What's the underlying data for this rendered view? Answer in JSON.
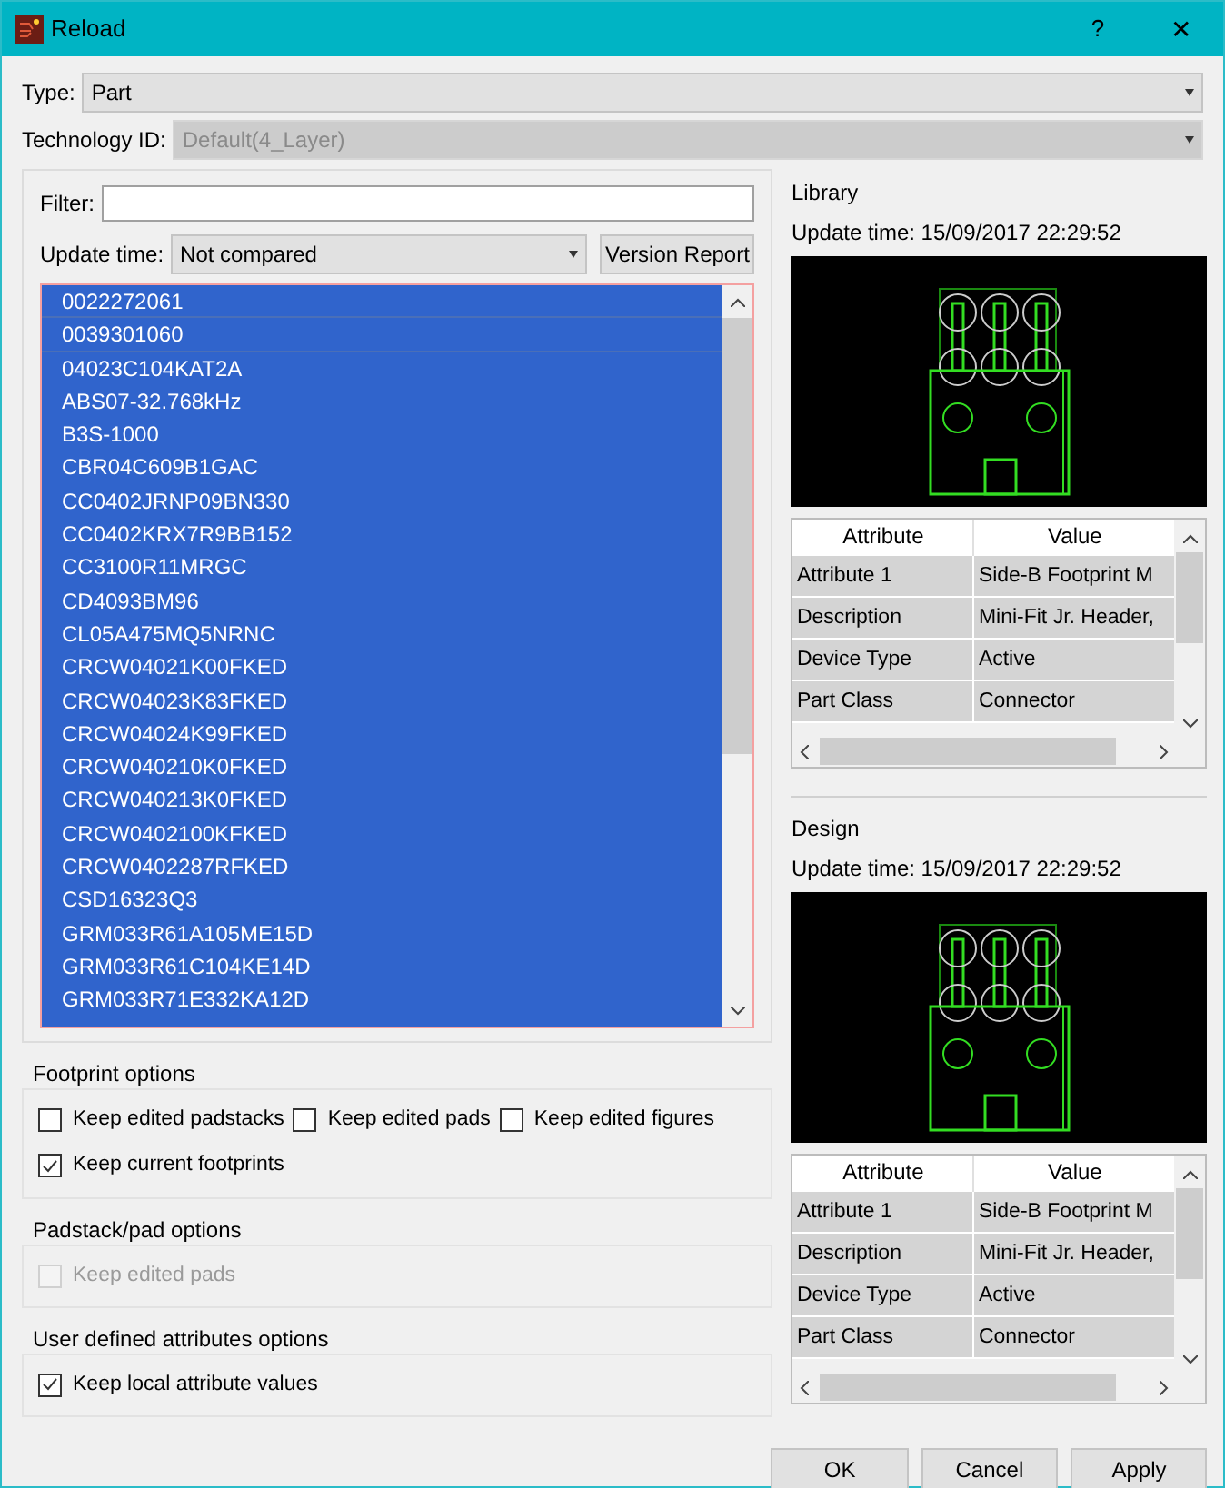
{
  "window": {
    "title": "Reload",
    "help": "?",
    "close": "✕"
  },
  "type": {
    "label": "Type:",
    "value": "Part",
    "disabled": false
  },
  "technology": {
    "label": "Technology ID:",
    "value": "Default(4_Layer)",
    "disabled": true
  },
  "filter": {
    "label": "Filter:"
  },
  "update_time": {
    "label": "Update time:",
    "value": "Not compared"
  },
  "version_report": "Version Report",
  "parts": [
    {
      "name": "0022272061",
      "selected": true
    },
    {
      "name": "0039301060",
      "selected": true
    },
    {
      "name": "04023C104KAT2A",
      "selected": true
    },
    {
      "name": "ABS07-32.768kHz",
      "selected": true
    },
    {
      "name": "B3S-1000",
      "selected": true
    },
    {
      "name": "CBR04C609B1GAC",
      "selected": true
    },
    {
      "name": "CC0402JRNP09BN330",
      "selected": true
    },
    {
      "name": "CC0402KRX7R9BB152",
      "selected": true
    },
    {
      "name": "CC3100R11MRGC",
      "selected": true
    },
    {
      "name": "CD4093BM96",
      "selected": true
    },
    {
      "name": "CL05A475MQ5NRNC",
      "selected": true
    },
    {
      "name": "CRCW04021K00FKED",
      "selected": true
    },
    {
      "name": "CRCW04023K83FKED",
      "selected": true
    },
    {
      "name": "CRCW04024K99FKED",
      "selected": true
    },
    {
      "name": "CRCW040210K0FKED",
      "selected": true
    },
    {
      "name": "CRCW040213K0FKED",
      "selected": true
    },
    {
      "name": "CRCW0402100KFKED",
      "selected": true
    },
    {
      "name": "CRCW0402287RFKED",
      "selected": true
    },
    {
      "name": "CSD16323Q3",
      "selected": true
    },
    {
      "name": "GRM033R61A105ME15D",
      "selected": true
    },
    {
      "name": "GRM033R61C104KE14D",
      "selected": true
    },
    {
      "name": "GRM033R71E332KA12D",
      "selected": true
    }
  ],
  "option_groups": [
    {
      "title": "Footprint options",
      "options": [
        {
          "label": "Keep edited padstacks",
          "checked": false,
          "disabled": false
        },
        {
          "label": "Keep edited pads",
          "checked": false,
          "disabled": false
        },
        {
          "label": "Keep edited figures",
          "checked": false,
          "disabled": false
        },
        {
          "label": "Keep current footprints",
          "checked": true,
          "disabled": false
        }
      ]
    },
    {
      "title": "Padstack/pad options",
      "options": [
        {
          "label": "Keep edited pads",
          "checked": false,
          "disabled": true
        }
      ]
    },
    {
      "title": "User defined attributes options",
      "options": [
        {
          "label": "Keep local attribute values",
          "checked": true,
          "disabled": false
        }
      ]
    }
  ],
  "panels": [
    {
      "title": "Library",
      "update_time": "Update time: 15/09/2017 22:29:52",
      "columns": [
        "Attribute",
        "Value"
      ],
      "rows": [
        [
          "Attribute 1",
          "Side-B Footprint M"
        ],
        [
          "Description",
          "Mini-Fit Jr. Header,"
        ],
        [
          "Device Type",
          "Active"
        ],
        [
          "Part Class",
          "Connector"
        ]
      ]
    },
    {
      "title": "Design",
      "update_time": "Update time: 15/09/2017 22:29:52",
      "columns": [
        "Attribute",
        "Value"
      ],
      "rows": [
        [
          "Attribute 1",
          "Side-B Footprint M"
        ],
        [
          "Description",
          "Mini-Fit Jr. Header,"
        ],
        [
          "Device Type",
          "Active"
        ],
        [
          "Part Class",
          "Connector"
        ]
      ]
    }
  ],
  "buttons": [
    "OK",
    "Cancel",
    "Apply"
  ]
}
